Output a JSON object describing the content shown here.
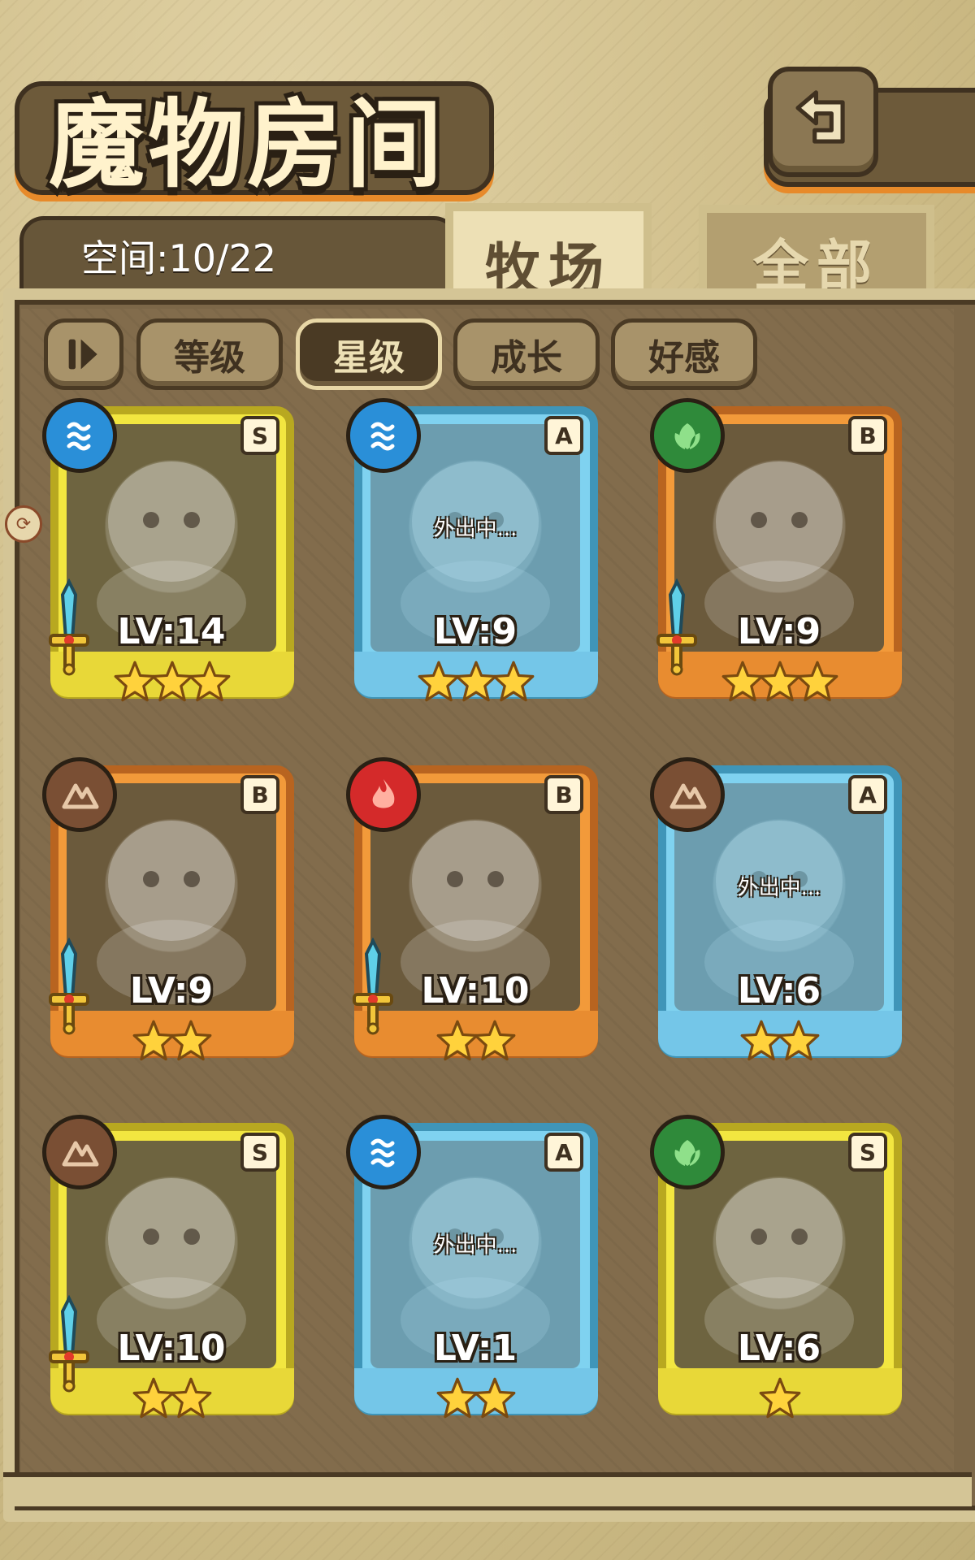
{
  "header": {
    "title": "魔物房间"
  },
  "space": "空间:10/22",
  "tabs": [
    {
      "label": "牧场",
      "active": true
    },
    {
      "label": "全部",
      "active": false
    }
  ],
  "filters": [
    {
      "label": "等级",
      "selected": false
    },
    {
      "label": "星级",
      "selected": true
    },
    {
      "label": "成长",
      "selected": false
    },
    {
      "label": "好感",
      "selected": false
    }
  ],
  "colors": {
    "rank_S": "#f2e640",
    "rank_A": "#7fd2f0",
    "rank_B": "#f29a3a",
    "water": "#2a8fd8",
    "grass": "#2f8a3a",
    "earth": "#7a4f34",
    "fire": "#d42a2a"
  },
  "monsters": [
    {
      "rank": "S",
      "element": "water",
      "level": "LV:14",
      "stars": 3,
      "away": "",
      "weapon": true
    },
    {
      "rank": "A",
      "element": "water",
      "level": "LV:9",
      "stars": 3,
      "away": "外出中...",
      "weapon": false
    },
    {
      "rank": "B",
      "element": "grass",
      "level": "LV:9",
      "stars": 3,
      "away": "",
      "weapon": true
    },
    {
      "rank": "B",
      "element": "earth",
      "level": "LV:9",
      "stars": 2,
      "away": "",
      "weapon": true
    },
    {
      "rank": "B",
      "element": "fire",
      "level": "LV:10",
      "stars": 2,
      "away": "",
      "weapon": true
    },
    {
      "rank": "A",
      "element": "earth",
      "level": "LV:6",
      "stars": 2,
      "away": "外出中...",
      "weapon": false
    },
    {
      "rank": "S",
      "element": "earth",
      "level": "LV:10",
      "stars": 2,
      "away": "",
      "weapon": true
    },
    {
      "rank": "A",
      "element": "water",
      "level": "LV:1",
      "stars": 2,
      "away": "外出中...",
      "weapon": false
    },
    {
      "rank": "S",
      "element": "grass",
      "level": "LV:6",
      "stars": 1,
      "away": "",
      "weapon": false
    }
  ]
}
